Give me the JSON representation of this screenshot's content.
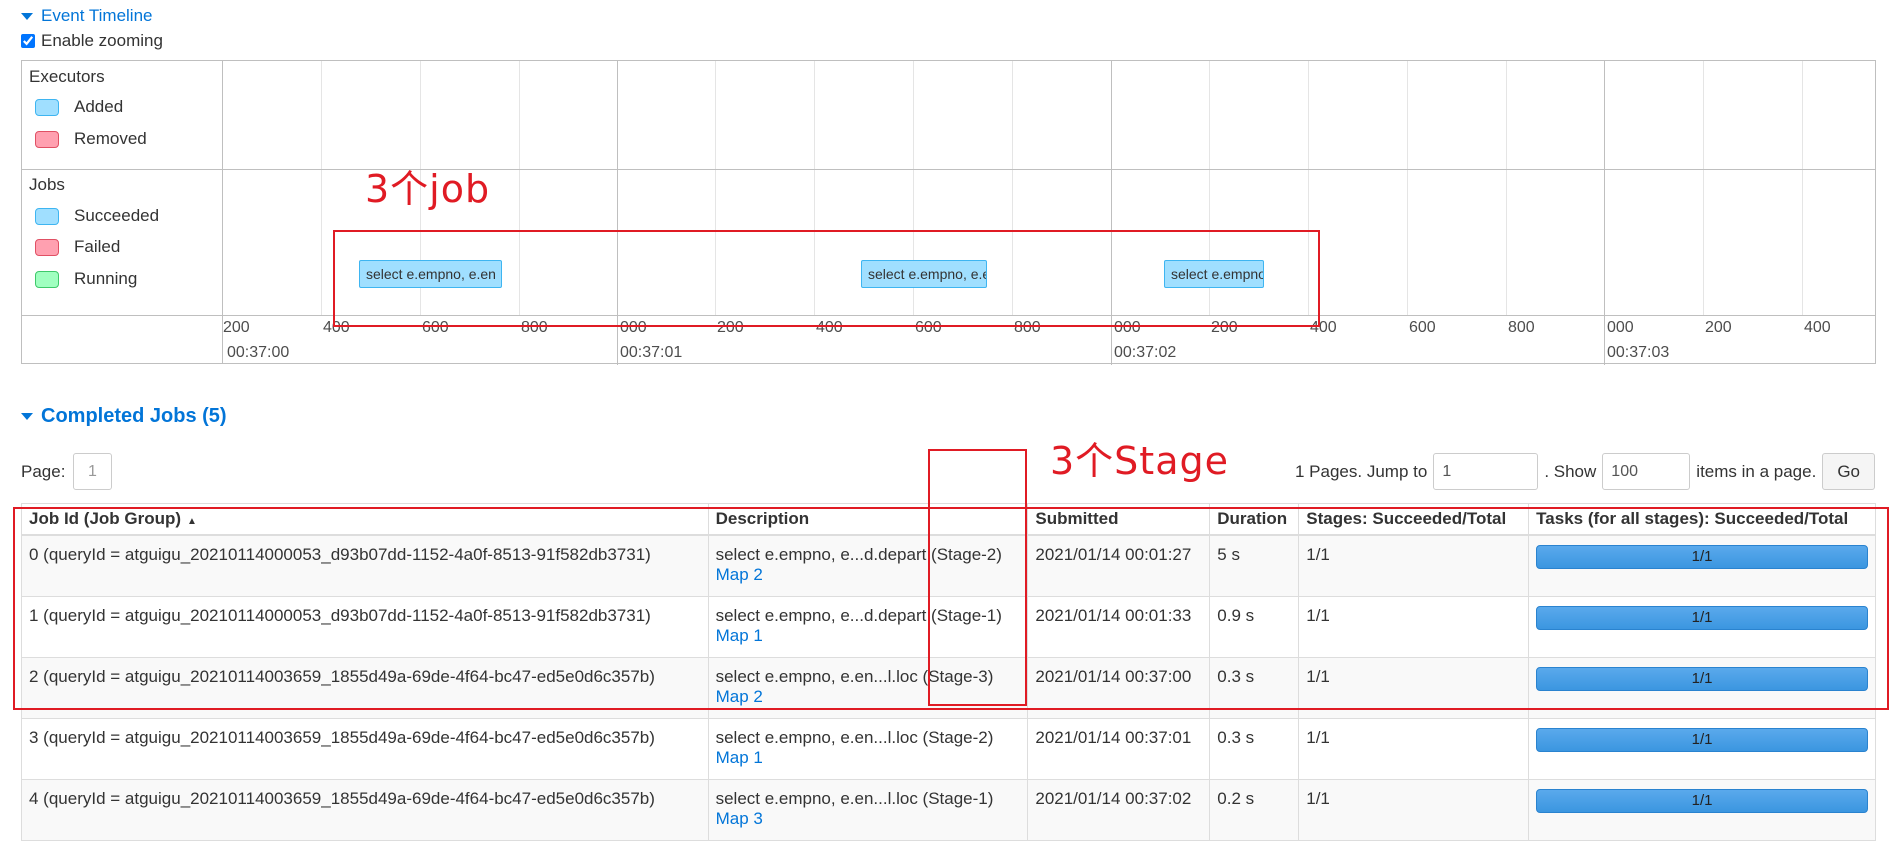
{
  "event_timeline": {
    "title": "Event Timeline",
    "zoom_label": "Enable zooming",
    "zoom_checked": true
  },
  "legend": {
    "executors_title": "Executors",
    "executors": [
      {
        "label": "Added",
        "color": "#a0dfff"
      },
      {
        "label": "Removed",
        "color": "#ffa0b0"
      }
    ],
    "jobs_title": "Jobs",
    "jobs": [
      {
        "label": "Succeeded",
        "color": "#a0dfff"
      },
      {
        "label": "Failed",
        "color": "#ffa0b0"
      },
      {
        "label": "Running",
        "color": "#a0ffc0"
      }
    ]
  },
  "timeline_axis": {
    "ticks": [
      "200",
      "400",
      "600",
      "800",
      "000",
      "200",
      "400",
      "600",
      "800",
      "000",
      "200",
      "400",
      "600",
      "800",
      "000",
      "200",
      "400"
    ],
    "major_labels": [
      "00:37:00",
      "00:37:01",
      "00:37:02",
      "00:37:03"
    ]
  },
  "timeline_jobs": [
    {
      "label": "select e.empno, e.en"
    },
    {
      "label": "select e.empno, e.en"
    },
    {
      "label": "select e.empno"
    }
  ],
  "completed": {
    "title": "Completed Jobs (5)"
  },
  "paging": {
    "page_label": "Page:",
    "page_value": "1",
    "pages_text": "1 Pages. Jump to",
    "jump_value": "1",
    "show_text": ". Show",
    "show_value": "100",
    "items_text": "items in a page.",
    "go_label": "Go"
  },
  "table": {
    "headers": [
      "Job Id (Job Group)",
      "Description",
      "Submitted",
      "Duration",
      "Stages: Succeeded/Total",
      "Tasks (for all stages): Succeeded/Total"
    ],
    "sort_indicator": "▲",
    "rows": [
      {
        "job": "0 (queryId = atguigu_20210114000053_d93b07dd-1152-4a0f-8513-91f582db3731)",
        "desc": "select e.empno, e...d.depart (Stage-2)",
        "link": "Map 2",
        "submitted": "2021/01/14 00:01:27",
        "duration": "5 s",
        "stages": "1/1",
        "tasks": "1/1",
        "tasks_fraction": 1.0
      },
      {
        "job": "1 (queryId = atguigu_20210114000053_d93b07dd-1152-4a0f-8513-91f582db3731)",
        "desc": "select e.empno, e...d.depart (Stage-1)",
        "link": "Map 1",
        "submitted": "2021/01/14 00:01:33",
        "duration": "0.9 s",
        "stages": "1/1",
        "tasks": "1/1",
        "tasks_fraction": 1.0
      },
      {
        "job": "2 (queryId = atguigu_20210114003659_1855d49a-69de-4f64-bc47-ed5e0d6c357b)",
        "desc": "select e.empno, e.en...l.loc (Stage-3)",
        "link": "Map 2",
        "submitted": "2021/01/14 00:37:00",
        "duration": "0.3 s",
        "stages": "1/1",
        "tasks": "1/1",
        "tasks_fraction": 1.0
      },
      {
        "job": "3 (queryId = atguigu_20210114003659_1855d49a-69de-4f64-bc47-ed5e0d6c357b)",
        "desc": "select e.empno, e.en...l.loc (Stage-2)",
        "link": "Map 1",
        "submitted": "2021/01/14 00:37:01",
        "duration": "0.3 s",
        "stages": "1/1",
        "tasks": "1/1",
        "tasks_fraction": 1.0
      },
      {
        "job": "4 (queryId = atguigu_20210114003659_1855d49a-69de-4f64-bc47-ed5e0d6c357b)",
        "desc": "select e.empno, e.en...l.loc (Stage-1)",
        "link": "Map 3",
        "submitted": "2021/01/14 00:37:02",
        "duration": "0.2 s",
        "stages": "1/1",
        "tasks": "1/1",
        "tasks_fraction": 1.0
      }
    ]
  },
  "annotations": {
    "jobs_note": "3个job",
    "stage_note": "3个Stage",
    "color": "#e01b24"
  }
}
